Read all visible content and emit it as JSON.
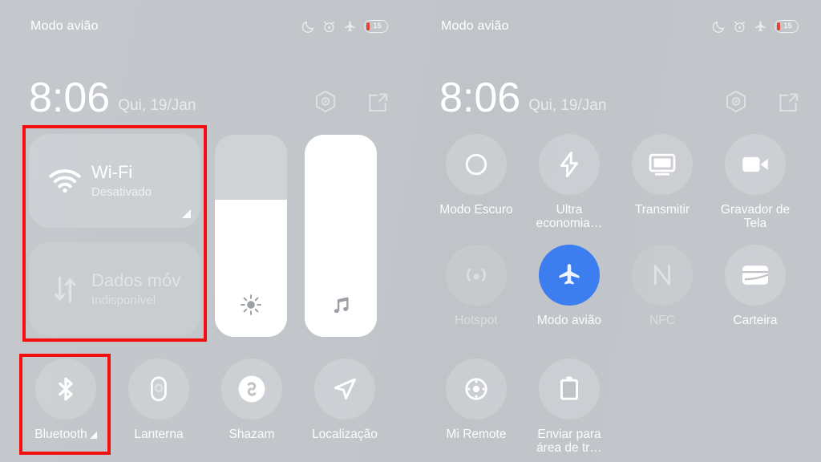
{
  "status": {
    "label": "Modo avião",
    "icons": [
      "do-not-disturb-icon",
      "alarm-icon",
      "airplane-icon",
      "battery-icon"
    ],
    "battery_level": "15"
  },
  "header": {
    "time": "8:06",
    "date": "Qui, 19/Jan",
    "actions": [
      "settings-icon",
      "edit-icon"
    ]
  },
  "left_panel": {
    "big_tiles": [
      {
        "title": "Wi-Fi",
        "subtitle": "Desativado",
        "icon": "wifi-icon",
        "state": "off",
        "expandable": true
      },
      {
        "title": "Dados móv",
        "subtitle": "Indisponível",
        "icon": "mobile-data-icon",
        "state": "unavailable",
        "expandable": false
      }
    ],
    "sliders": [
      {
        "name": "brightness",
        "icon": "brightness-icon",
        "value": 68
      },
      {
        "name": "volume",
        "icon": "music-note-icon",
        "value": 100
      }
    ],
    "tiles": [
      {
        "label": "Bluetooth",
        "icon": "bluetooth-icon",
        "state": "off",
        "expandable": true
      },
      {
        "label": "Lanterna",
        "icon": "flashlight-icon",
        "state": "off",
        "expandable": false
      },
      {
        "label": "Shazam",
        "icon": "shazam-icon",
        "state": "off",
        "expandable": false
      },
      {
        "label": "Localização",
        "icon": "location-icon",
        "state": "off",
        "expandable": false
      }
    ]
  },
  "right_panel": {
    "rows": [
      [
        {
          "label": "Modo Escuro",
          "icon": "dark-mode-icon",
          "state": "off"
        },
        {
          "label": "Ultra economia…",
          "icon": "ultra-battery-saver-icon",
          "state": "off"
        },
        {
          "label": "Transmitir",
          "icon": "cast-icon",
          "state": "off"
        },
        {
          "label": "Gravador de Tela",
          "icon": "screen-recorder-icon",
          "state": "off"
        }
      ],
      [
        {
          "label": "Hotspot",
          "icon": "hotspot-icon",
          "state": "disabled"
        },
        {
          "label": "Modo avião",
          "icon": "airplane-icon",
          "state": "on"
        },
        {
          "label": "NFC",
          "icon": "nfc-icon",
          "state": "disabled"
        },
        {
          "label": "Carteira",
          "icon": "wallet-icon",
          "state": "off"
        }
      ],
      [
        {
          "label": "Mi Remote",
          "icon": "remote-control-icon",
          "state": "off"
        },
        {
          "label": "Enviar para área de tr…",
          "icon": "clipboard-icon",
          "state": "off"
        }
      ]
    ]
  },
  "annotations": [
    {
      "name": "redbox-connectivity",
      "color": "#f40e0e"
    },
    {
      "name": "redbox-bluetooth",
      "color": "#f40e0e"
    },
    {
      "name": "redbox-airplane",
      "color": "#f40e0e"
    }
  ]
}
